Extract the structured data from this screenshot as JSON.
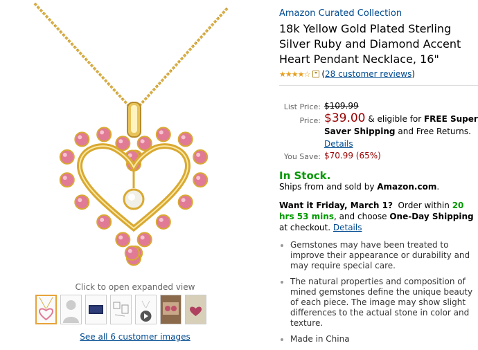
{
  "gallery": {
    "caption": "Click to open expanded view",
    "see_all": "See all 6 customer images",
    "thumbnails": [
      "pendant-front",
      "customer-photo-placeholder",
      "gift-box",
      "product-diagram",
      "video-thumbnail",
      "customer-photo-1",
      "customer-photo-2"
    ]
  },
  "product": {
    "brand": "Amazon Curated Collection",
    "title": "18k Yellow Gold Plated Sterling Silver Ruby and Diamond Accent Heart Pendant Necklace, 16\"",
    "rating_stars": "★★★★☆",
    "rating_value": 4,
    "reviews_link": "28 customer reviews"
  },
  "pricing": {
    "list_label": "List Price:",
    "list_price": "$109.99",
    "price_label": "Price:",
    "price": "$39.00",
    "eligible_text": "& eligible for",
    "free_shipping": "FREE Super Saver Shipping",
    "and_text": "and Free Returns.",
    "details": "Details",
    "save_label": "You Save:",
    "save_value": "$70.99 (65%)"
  },
  "availability": {
    "stock": "In Stock.",
    "ships_prefix": "Ships from and sold by ",
    "seller": "Amazon.com",
    "ships_suffix": "."
  },
  "delivery": {
    "want": "Want it Friday, March 1?",
    "order_within": "Order within",
    "countdown": "20 hrs 53 mins",
    "choose": ", and choose",
    "one_day": "One-Day Shipping",
    "at_checkout": "at checkout.",
    "details": "Details"
  },
  "bullets": [
    "Gemstones may have been treated to improve their appearance or durability and may require special care.",
    "The natural properties and composition of mined gemstones define the unique beauty of each piece. The image may show slight differences to the actual stone in color and texture.",
    "Made in China"
  ],
  "colors": {
    "link": "#004b91",
    "price": "#990000",
    "stock": "#009900",
    "gold": "#d9a932",
    "ruby": "#e07a95"
  }
}
